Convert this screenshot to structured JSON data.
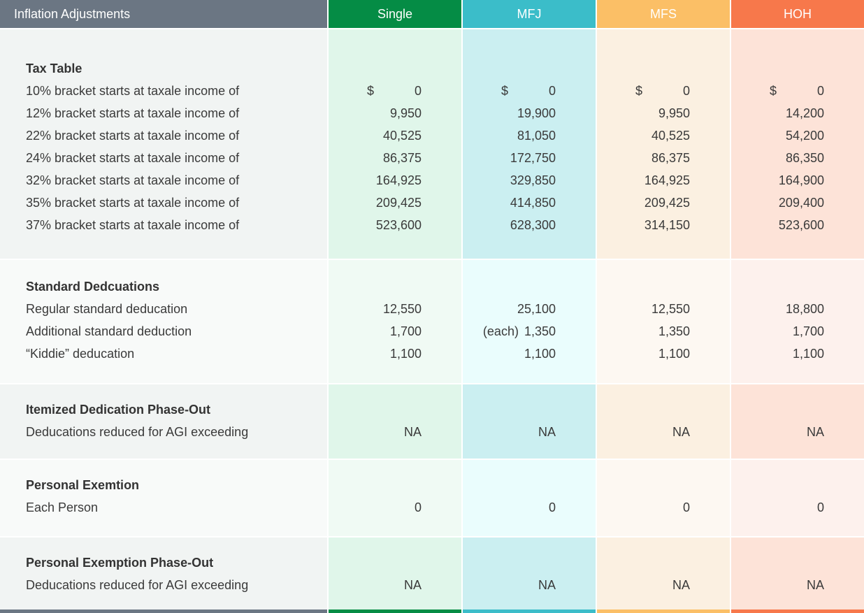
{
  "header": {
    "label": "Inflation Adjustments",
    "columns": [
      "Single",
      "MFJ",
      "MFS",
      "HOH"
    ],
    "colors": [
      "#6b7683",
      "#058c45",
      "#3bbdc9",
      "#fbbf66",
      "#f7784b"
    ]
  },
  "sections": {
    "tax_table": {
      "title": "Tax Table",
      "rows": [
        {
          "label": "10% bracket starts at taxale income of",
          "currency": "$",
          "values": [
            "0",
            "0",
            "0",
            "0"
          ]
        },
        {
          "label": "12% bracket starts at taxale income of",
          "values": [
            "9,950",
            "19,900",
            "9,950",
            "14,200"
          ]
        },
        {
          "label": "22% bracket starts at taxale income of",
          "values": [
            "40,525",
            "81,050",
            "40,525",
            "54,200"
          ]
        },
        {
          "label": "24% bracket starts at taxale income of",
          "values": [
            "86,375",
            "172,750",
            "86,375",
            "86,350"
          ]
        },
        {
          "label": "32% bracket starts at taxale income of",
          "values": [
            "164,925",
            "329,850",
            "164,925",
            "164,900"
          ]
        },
        {
          "label": "35% bracket starts at taxale income of",
          "values": [
            "209,425",
            "414,850",
            "209,425",
            "209,400"
          ]
        },
        {
          "label": "37% bracket starts at taxale income of",
          "values": [
            "523,600",
            "628,300",
            "314,150",
            "523,600"
          ]
        }
      ]
    },
    "standard_deductions": {
      "title": "Standard Dedcuations",
      "rows": [
        {
          "label": "Regular standard deducation",
          "values": [
            "12,550",
            "25,100",
            "12,550",
            "18,800"
          ]
        },
        {
          "label": "Additional standard deduction",
          "values": [
            "1,700",
            "1,350",
            "1,350",
            "1,700"
          ],
          "mfj_prefix": "(each)"
        },
        {
          "label": "“Kiddie” deducation",
          "values": [
            "1,100",
            "1,100",
            "1,100",
            "1,100"
          ]
        }
      ]
    },
    "itemized": {
      "title": "Itemized Dedication Phase-Out",
      "rows": [
        {
          "label": "Deducations reduced for AGI exceeding",
          "values": [
            "NA",
            "NA",
            "NA",
            "NA"
          ]
        }
      ]
    },
    "personal_exemption": {
      "title": "Personal Exemtion",
      "rows": [
        {
          "label": "Each Person",
          "values": [
            "0",
            "0",
            "0",
            "0"
          ]
        }
      ]
    },
    "exemption_phaseout": {
      "title": "Personal Exemption Phase-Out",
      "rows": [
        {
          "label": "Deducations reduced for AGI exceeding",
          "values": [
            "NA",
            "NA",
            "NA",
            "NA"
          ]
        }
      ]
    }
  }
}
